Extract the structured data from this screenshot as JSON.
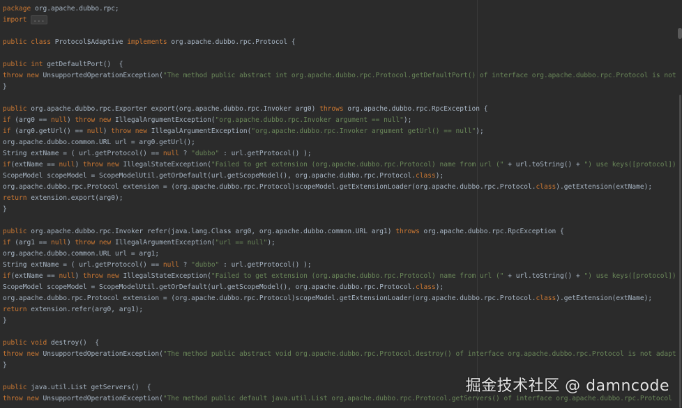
{
  "editor": {
    "theme": {
      "background": "#2b2b2b",
      "keyword": "#cc7832",
      "string": "#6a8759",
      "text": "#a9b7c6"
    },
    "lines": [
      [
        [
          "kw",
          "package"
        ],
        [
          "t",
          " org.apache.dubbo.rpc;"
        ]
      ],
      [
        [
          "kw",
          "import"
        ],
        [
          "t",
          " "
        ],
        [
          "fold",
          "..."
        ]
      ],
      [],
      [
        [
          "kw",
          "public class"
        ],
        [
          "t",
          " Protocol$Adaptive "
        ],
        [
          "kw",
          "implements"
        ],
        [
          "t",
          " org.apache.dubbo.rpc.Protocol {"
        ]
      ],
      [],
      [
        [
          "kw",
          "public int"
        ],
        [
          "t",
          " getDefaultPort()  {"
        ]
      ],
      [
        [
          "kw",
          "throw new"
        ],
        [
          "t",
          " UnsupportedOperationException("
        ],
        [
          "str",
          "\"The method public abstract int org.apache.dubbo.rpc.Protocol.getDefaultPort() of interface org.apache.dubbo.rpc.Protocol is not adaptive method!\""
        ],
        [
          "t",
          ");"
        ]
      ],
      [
        [
          "t",
          "}"
        ]
      ],
      [],
      [
        [
          "kw",
          "public"
        ],
        [
          "t",
          " org.apache.dubbo.rpc.Exporter export(org.apache.dubbo.rpc.Invoker arg0) "
        ],
        [
          "kw",
          "throws"
        ],
        [
          "t",
          " org.apache.dubbo.rpc.RpcException {"
        ]
      ],
      [
        [
          "kw",
          "if"
        ],
        [
          "t",
          " (arg0 == "
        ],
        [
          "kw",
          "null"
        ],
        [
          "t",
          ") "
        ],
        [
          "kw",
          "throw new"
        ],
        [
          "t",
          " IllegalArgumentException("
        ],
        [
          "str",
          "\"org.apache.dubbo.rpc.Invoker argument == null\""
        ],
        [
          "t",
          ");"
        ]
      ],
      [
        [
          "kw",
          "if"
        ],
        [
          "t",
          " (arg0.getUrl() == "
        ],
        [
          "kw",
          "null"
        ],
        [
          "t",
          ") "
        ],
        [
          "kw",
          "throw new"
        ],
        [
          "t",
          " IllegalArgumentException("
        ],
        [
          "str",
          "\"org.apache.dubbo.rpc.Invoker argument getUrl() == null\""
        ],
        [
          "t",
          ");"
        ]
      ],
      [
        [
          "t",
          "org.apache.dubbo.common.URL url = arg0.getUrl();"
        ]
      ],
      [
        [
          "t",
          "String extName = ( url.getProtocol() == "
        ],
        [
          "kw",
          "null"
        ],
        [
          "t",
          " ? "
        ],
        [
          "str",
          "\"dubbo\""
        ],
        [
          "t",
          " : url.getProtocol() );"
        ]
      ],
      [
        [
          "kw",
          "if"
        ],
        [
          "t",
          "(extName == "
        ],
        [
          "kw",
          "null"
        ],
        [
          "t",
          ") "
        ],
        [
          "kw",
          "throw new"
        ],
        [
          "t",
          " IllegalStateException("
        ],
        [
          "str",
          "\"Failed to get extension (org.apache.dubbo.rpc.Protocol) name from url (\""
        ],
        [
          "t",
          " + url.toString() + "
        ],
        [
          "str",
          "\") use keys([protocol])\""
        ],
        [
          "t",
          ");"
        ]
      ],
      [
        [
          "t",
          "ScopeModel scopeModel = ScopeModelUtil.getOrDefault(url.getScopeModel(), org.apache.dubbo.rpc.Protocol."
        ],
        [
          "kw",
          "class"
        ],
        [
          "t",
          ");"
        ]
      ],
      [
        [
          "t",
          "org.apache.dubbo.rpc.Protocol extension = (org.apache.dubbo.rpc.Protocol)scopeModel.getExtensionLoader(org.apache.dubbo.rpc.Protocol."
        ],
        [
          "kw",
          "class"
        ],
        [
          "t",
          ").getExtension(extName);"
        ]
      ],
      [
        [
          "kw",
          "return"
        ],
        [
          "t",
          " extension.export(arg0);"
        ]
      ],
      [
        [
          "t",
          "}"
        ]
      ],
      [],
      [
        [
          "kw",
          "public"
        ],
        [
          "t",
          " org.apache.dubbo.rpc.Invoker refer(java.lang.Class arg0, org.apache.dubbo.common.URL arg1) "
        ],
        [
          "kw",
          "throws"
        ],
        [
          "t",
          " org.apache.dubbo.rpc.RpcException {"
        ]
      ],
      [
        [
          "kw",
          "if"
        ],
        [
          "t",
          " (arg1 == "
        ],
        [
          "kw",
          "null"
        ],
        [
          "t",
          ") "
        ],
        [
          "kw",
          "throw new"
        ],
        [
          "t",
          " IllegalArgumentException("
        ],
        [
          "str",
          "\"url == null\""
        ],
        [
          "t",
          ");"
        ]
      ],
      [
        [
          "t",
          "org.apache.dubbo.common.URL url = arg1;"
        ]
      ],
      [
        [
          "t",
          "String extName = ( url.getProtocol() == "
        ],
        [
          "kw",
          "null"
        ],
        [
          "t",
          " ? "
        ],
        [
          "str",
          "\"dubbo\""
        ],
        [
          "t",
          " : url.getProtocol() );"
        ]
      ],
      [
        [
          "kw",
          "if"
        ],
        [
          "t",
          "(extName == "
        ],
        [
          "kw",
          "null"
        ],
        [
          "t",
          ") "
        ],
        [
          "kw",
          "throw new"
        ],
        [
          "t",
          " IllegalStateException("
        ],
        [
          "str",
          "\"Failed to get extension (org.apache.dubbo.rpc.Protocol) name from url (\""
        ],
        [
          "t",
          " + url.toString() + "
        ],
        [
          "str",
          "\") use keys([protocol])\""
        ],
        [
          "t",
          ");"
        ]
      ],
      [
        [
          "t",
          "ScopeModel scopeModel = ScopeModelUtil.getOrDefault(url.getScopeModel(), org.apache.dubbo.rpc.Protocol."
        ],
        [
          "kw",
          "class"
        ],
        [
          "t",
          ");"
        ]
      ],
      [
        [
          "t",
          "org.apache.dubbo.rpc.Protocol extension = (org.apache.dubbo.rpc.Protocol)scopeModel.getExtensionLoader(org.apache.dubbo.rpc.Protocol."
        ],
        [
          "kw",
          "class"
        ],
        [
          "t",
          ").getExtension(extName);"
        ]
      ],
      [
        [
          "kw",
          "return"
        ],
        [
          "t",
          " extension.refer(arg0, arg1);"
        ]
      ],
      [
        [
          "t",
          "}"
        ]
      ],
      [],
      [
        [
          "kw",
          "public void"
        ],
        [
          "t",
          " destroy()  {"
        ]
      ],
      [
        [
          "kw",
          "throw new"
        ],
        [
          "t",
          " UnsupportedOperationException("
        ],
        [
          "str",
          "\"The method public abstract void org.apache.dubbo.rpc.Protocol.destroy() of interface org.apache.dubbo.rpc.Protocol is not adaptive method!\""
        ],
        [
          "t",
          ");"
        ]
      ],
      [
        [
          "t",
          "}"
        ]
      ],
      [],
      [
        [
          "kw",
          "public"
        ],
        [
          "t",
          " java.util.List getServers()  {"
        ]
      ],
      [
        [
          "kw",
          "throw new"
        ],
        [
          "t",
          " UnsupportedOperationException("
        ],
        [
          "str",
          "\"The method public default java.util.List org.apache.dubbo.rpc.Protocol.getServers() of interface org.apache.dubbo.rpc.Protocol is not adaptive method!\""
        ],
        [
          "t",
          ");"
        ]
      ]
    ]
  },
  "watermark": {
    "text": "掘金技术社区 @ damncode"
  }
}
